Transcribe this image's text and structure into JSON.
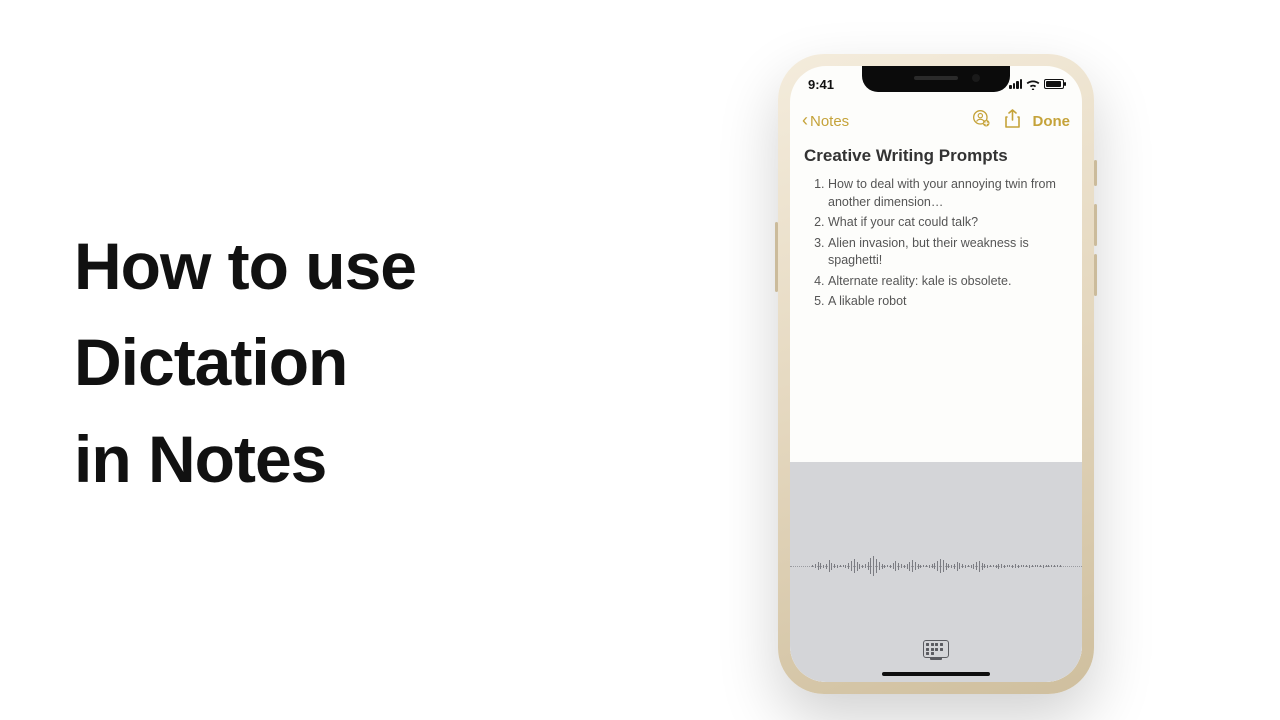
{
  "headline": {
    "line1": "How to use",
    "line2": "Dictation",
    "line3": "in Notes"
  },
  "status": {
    "time": "9:41"
  },
  "nav": {
    "back_label": "Notes",
    "done_label": "Done"
  },
  "note": {
    "title": "Creative Writing Prompts",
    "items": [
      "How to deal with your annoying twin from another dimension…",
      "What if your cat could talk?",
      "Alien invasion, but their weakness is spaghetti!",
      "Alternate reality: kale is obsolete.",
      "A likable robot"
    ]
  }
}
